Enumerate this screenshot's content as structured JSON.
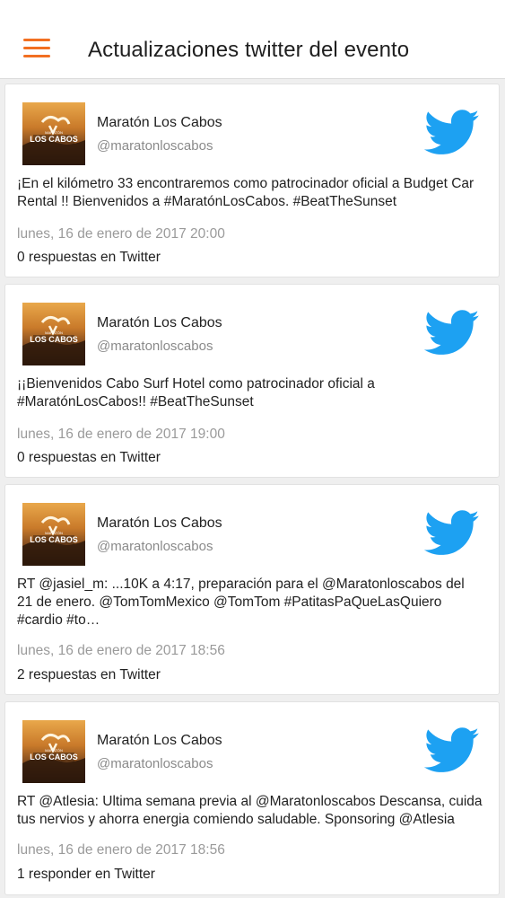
{
  "header": {
    "title": "Actualizaciones twitter del evento",
    "menu_icon": "hamburger-menu-icon"
  },
  "colors": {
    "accent": "#f26f21",
    "twitter_blue": "#1da1f2"
  },
  "tweets": [
    {
      "author": "Maratón Los Cabos",
      "handle": "@maratonloscabos",
      "text": "¡En el kilómetro 33 encontraremos como patrocinador oficial a Budget Car Rental !! Bienvenidos a #MaratónLosCabos. #BeatTheSunset",
      "date": "lunes, 16 de enero de 2017 20:00",
      "replies": "0 respuestas en Twitter"
    },
    {
      "author": "Maratón Los Cabos",
      "handle": "@maratonloscabos",
      "text": "¡¡Bienvenidos Cabo Surf Hotel como patrocinador oficial a #MaratónLosCabos!! #BeatTheSunset",
      "date": "lunes, 16 de enero de 2017 19:00",
      "replies": "0 respuestas en Twitter"
    },
    {
      "author": "Maratón Los Cabos",
      "handle": "@maratonloscabos",
      "text": "RT @jasiel_m: ...10K a 4:17, preparación para el @Maratonloscabos del 21 de enero. @TomTomMexico @TomTom #PatitasPaQueLasQuiero #cardio #to…",
      "date": "lunes, 16 de enero de 2017 18:56",
      "replies": "2 respuestas en Twitter"
    },
    {
      "author": "Maratón Los Cabos",
      "handle": "@maratonloscabos",
      "text": "RT @Atlesia: Ultima semana previa al @Maratonloscabos Descansa, cuida tus nervios y ahorra energia comiendo saludable. Sponsoring @Atlesia",
      "date": "lunes, 16 de enero de 2017 18:56",
      "replies": "1 responder en Twitter"
    }
  ]
}
